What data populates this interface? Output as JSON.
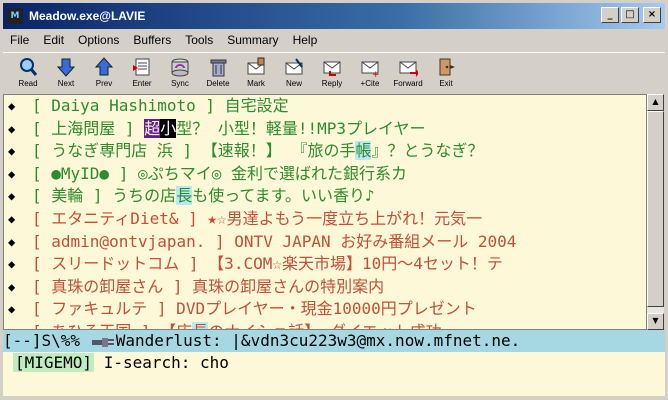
{
  "window": {
    "title": "Meadow.exe@LAVIE",
    "icon_label": "M",
    "buttons": {
      "minimize": "_",
      "maximize": "□",
      "close": "×"
    }
  },
  "menubar": [
    "File",
    "Edit",
    "Options",
    "Buffers",
    "Tools",
    "Summary",
    "Help"
  ],
  "toolbar": [
    {
      "label": "Read",
      "icon": "magnifier-icon"
    },
    {
      "label": "Next",
      "icon": "arrow-down-icon"
    },
    {
      "label": "Prev",
      "icon": "arrow-up-icon"
    },
    {
      "label": "Enter",
      "icon": "enter-icon"
    },
    {
      "label": "Sync",
      "icon": "sync-icon"
    },
    {
      "label": "Delete",
      "icon": "delete-icon"
    },
    {
      "label": "Mark",
      "icon": "mark-icon"
    },
    {
      "label": "New",
      "icon": "new-icon"
    },
    {
      "label": "Reply",
      "icon": "reply-icon"
    },
    {
      "label": "+Cite",
      "icon": "cite-icon"
    },
    {
      "label": "Forward",
      "icon": "forward-icon"
    },
    {
      "label": "Exit",
      "icon": "exit-icon"
    }
  ],
  "summary_arrow": "◆",
  "summary": [
    {
      "sender": "[ Daiya Hashimoto  ]",
      "subject_a": " 自宅設定",
      "subject_b": "",
      "subject_c": "",
      "subject_d": "",
      "subject_e": "",
      "color": "green"
    },
    {
      "sender": "[ 上海問屋          ]",
      "subject_a": " ",
      "subject_b": "超",
      "subject_c": "小",
      "subject_d": "型？ 小型！軽量!!MP3プレイヤー",
      "subject_e": "",
      "color": "green"
    },
    {
      "sender": "[ うなぎ専門店 浜 ]",
      "subject_a": " 【速報！】 『旅の手",
      "subject_b": "帳",
      "subject_c": "』？とうなぎ？",
      "subject_d": "",
      "subject_e": "",
      "color": "green"
    },
    {
      "sender": "[ ●MyID●          ]",
      "subject_a": " ◎ぷちマイ◎ 金利で選ばれた銀行系カ",
      "subject_b": "",
      "subject_c": "",
      "subject_d": "",
      "subject_e": "",
      "color": "green"
    },
    {
      "sender": "[ 美輪              ]",
      "subject_a": " うちの店",
      "subject_b": "長",
      "subject_c": "も使ってます。いい香り♪",
      "subject_d": "",
      "subject_e": "",
      "color": "green"
    },
    {
      "sender": "[ エタニティDiet& ]",
      "subject_a": " ★☆男達よもう一度立ち上がれ！元気一",
      "subject_b": "",
      "subject_c": "",
      "subject_d": "",
      "subject_e": "",
      "color": "red"
    },
    {
      "sender": "[ admin@ontvjapan. ]",
      "subject_a": " ONTV JAPAN お好み番組メール 2004",
      "subject_b": "",
      "subject_c": "",
      "subject_d": "",
      "subject_e": "",
      "color": "red"
    },
    {
      "sender": "[ スリードットコム ]",
      "subject_a": " 【3.COM☆楽天市場】10円～4セット！テ",
      "subject_b": "",
      "subject_c": "",
      "subject_d": "",
      "subject_e": "",
      "color": "red"
    },
    {
      "sender": "[ 真珠の卸屋さん   ]",
      "subject_a": "     真珠の卸屋さんの特別案内",
      "subject_b": "",
      "subject_c": "",
      "subject_d": "",
      "subject_e": "",
      "color": "red"
    },
    {
      "sender": "[ ファキュルテ      ]",
      "subject_a": " DVDプレイヤー・現金10000円プレゼント",
      "subject_b": "",
      "subject_c": "",
      "subject_d": "",
      "subject_e": "",
      "color": "red"
    },
    {
      "sender": "[ あひる天国        ]",
      "subject_a": " 【店",
      "subject_b": "長",
      "subject_c": "のナイショ話】  ダイエット成功",
      "subject_d": "",
      "subject_e": "",
      "color": "red"
    }
  ],
  "modeline": {
    "left": "[--]S\\%%  ",
    "middle": "Wanderlust: |&vdn3cu223w3@mx.now.mfnet.ne."
  },
  "minibuffer": {
    "tag": "[MIGEMO]",
    "prompt": " I-search: cho"
  },
  "colors": {
    "green": "#2e8b2e",
    "red": "#c0503a",
    "background": "#fdf8d7",
    "modeline": "#a5d8e2"
  }
}
